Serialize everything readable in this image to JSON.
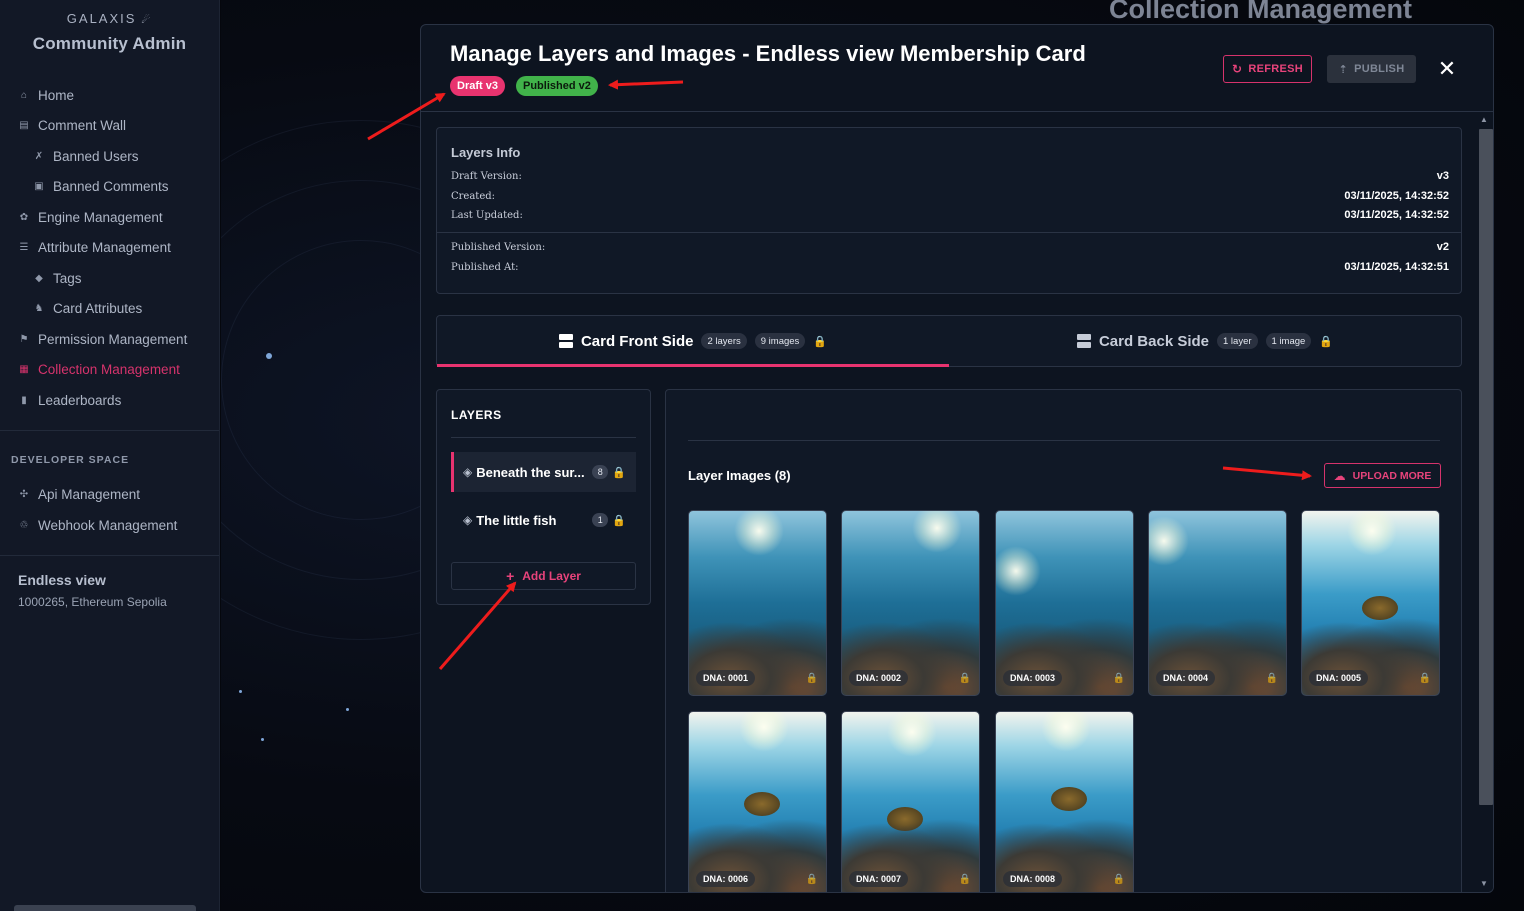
{
  "sidebar": {
    "brand": "GALAXIS",
    "title": "Community Admin",
    "items": [
      {
        "label": "Home",
        "icon": "home-icon"
      },
      {
        "label": "Comment Wall",
        "icon": "comment-icon"
      },
      {
        "label": "Banned Users",
        "icon": "banned-user-icon"
      },
      {
        "label": "Banned Comments",
        "icon": "banned-comment-icon"
      },
      {
        "label": "Engine Management",
        "icon": "gear-icon"
      },
      {
        "label": "Attribute Management",
        "icon": "sliders-icon"
      },
      {
        "label": "Tags",
        "icon": "tag-icon"
      },
      {
        "label": "Card Attributes",
        "icon": "card-attributes-icon"
      },
      {
        "label": "Permission Management",
        "icon": "permission-icon"
      },
      {
        "label": "Collection Management",
        "icon": "collection-icon"
      },
      {
        "label": "Leaderboards",
        "icon": "bar-chart-icon"
      }
    ],
    "developer_label": "DEVELOPER SPACE",
    "developer_items": [
      {
        "label": "Api Management",
        "icon": "api-icon"
      },
      {
        "label": "Webhook Management",
        "icon": "webhook-icon"
      }
    ],
    "community": {
      "name": "Endless view",
      "sub": "1000265, Ethereum Sepolia"
    }
  },
  "background": {
    "title": "Collection Management"
  },
  "modal": {
    "title": "Manage Layers and Images - Endless view Membership Card",
    "badge_draft": "Draft v3",
    "badge_published": "Published v2",
    "refresh_label": "REFRESH",
    "publish_label": "PUBLISH",
    "close_glyph": "✕"
  },
  "info": {
    "title": "Layers Info",
    "draft_version_label": "Draft Version:",
    "draft_version": "v3",
    "created_label": "Created:",
    "created": "03/11/2025, 14:32:52",
    "updated_label": "Last Updated:",
    "updated": "03/11/2025, 14:32:52",
    "published_version_label": "Published Version:",
    "published_version": "v2",
    "published_at_label": "Published At:",
    "published_at": "03/11/2025, 14:32:51"
  },
  "tabs": [
    {
      "label": "Card Front Side",
      "layers": "2 layers",
      "images": "9 images",
      "active": true
    },
    {
      "label": "Card Back Side",
      "layers": "1 layer",
      "images": "1 image",
      "active": false
    }
  ],
  "layers": {
    "title": "LAYERS",
    "items": [
      {
        "name": "Beneath the sur...",
        "count": "8",
        "active": true
      },
      {
        "name": "The little fish",
        "count": "1",
        "active": false
      }
    ],
    "add_label": "Add Layer"
  },
  "images": {
    "title": "Layer Images (8)",
    "upload_label": "UPLOAD MORE",
    "items": [
      {
        "dna": "DNA: 0001",
        "style": "photo"
      },
      {
        "dna": "DNA: 0002",
        "style": "photo"
      },
      {
        "dna": "DNA: 0003",
        "style": "photo"
      },
      {
        "dna": "DNA: 0004",
        "style": "photo"
      },
      {
        "dna": "DNA: 0005",
        "style": "paint"
      },
      {
        "dna": "DNA: 0006",
        "style": "paint"
      },
      {
        "dna": "DNA: 0007",
        "style": "paint"
      },
      {
        "dna": "DNA: 0008",
        "style": "paint"
      }
    ]
  },
  "colors": {
    "accent": "#e8336f",
    "success": "#41b34a",
    "sidebar_bg": "#121826",
    "modal_bg": "#0d1420",
    "annotation_arrow": "#ee1c1c"
  }
}
